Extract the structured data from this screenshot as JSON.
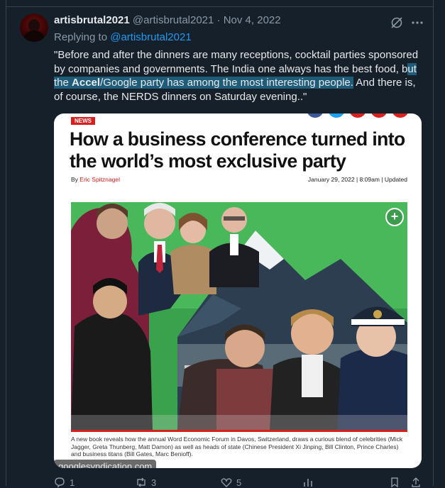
{
  "tweet": {
    "display_name": "artisbrutal2021",
    "handle": "@artisbrutal2021",
    "separator": "·",
    "date": "Nov 4, 2022",
    "replying_prefix": "Replying to ",
    "replying_to": "@artisbrutal2021",
    "text_before": "\"Before and after the dinners are many receptions, cocktail parties sponsored by companies and governments. The India one always has the best food, b",
    "text_highlight_1": "ut the ",
    "text_highlight_bold": "Accel",
    "text_highlight_2": "/Google party has among the most interesting people.",
    "text_after": " And there is, of course, the NERDS dinners on Saturday evening..\""
  },
  "card": {
    "badge": "NEWS",
    "headline": "How a business conference turned into the world’s most exclusive party",
    "by_prefix": "By ",
    "author": "Eric Spitznagel",
    "date": "January 29, 2022",
    "time": "8:09am",
    "updated": "Updated",
    "caption": "A new book reveals how the annual Word Economic Forum in Davos, Switzerland, draws a curious blend of celebrities (Mick Jagger, Greta Thunberg, Matt Damon) as well as heads of state (Chinese President Xi Jinping, Bill Clinton, Prince Charles) and business titans (Bill Gates, Marc Benioff).",
    "domain": "googlesyndication.com",
    "plus": "+"
  },
  "actions": {
    "reply_count": "1",
    "retweet_count": "3",
    "like_count": "5"
  },
  "colors": {
    "background": "#15202b",
    "accent": "#1d9bf0",
    "highlight": "#1f5c7a",
    "news_red": "#d8211f"
  }
}
